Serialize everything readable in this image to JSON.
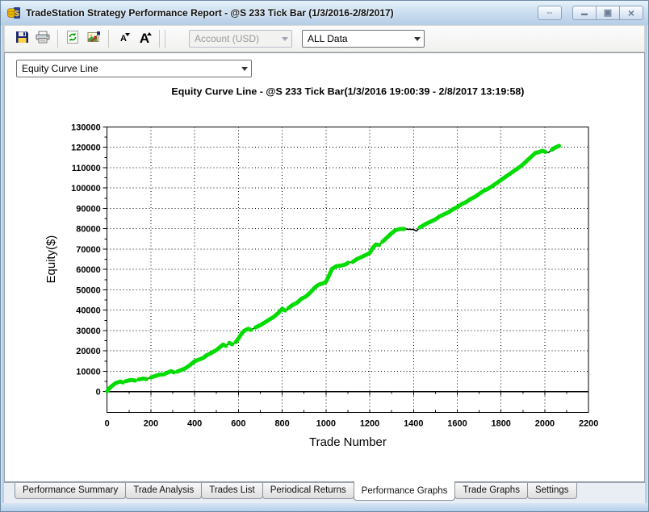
{
  "window": {
    "title": "TradeStation Strategy Performance Report - @S 233 Tick Bar (1/3/2016-2/8/2017)",
    "controls": {
      "resize": "⇔",
      "minimize": "▬",
      "restore": "▣",
      "close": "×"
    }
  },
  "toolbar": {
    "buttons": [
      {
        "name": "save"
      },
      {
        "name": "print"
      },
      {
        "name": "refresh"
      },
      {
        "name": "export-settings"
      },
      {
        "name": "decrease-font",
        "glyph": "A"
      },
      {
        "name": "increase-font",
        "glyph": "A"
      }
    ],
    "account_dropdown": {
      "value": "Account (USD)",
      "disabled": true
    },
    "data_dropdown": {
      "value": "ALL Data",
      "disabled": false
    }
  },
  "graph_selector": {
    "value": "Equity Curve Line"
  },
  "tabs": {
    "items": [
      "Performance Summary",
      "Trade Analysis",
      "Trades List",
      "Periodical Returns",
      "Performance Graphs",
      "Trade Graphs",
      "Settings"
    ],
    "active": "Performance Graphs"
  },
  "chart_data": {
    "type": "line",
    "title": "Equity Curve Line - @S 233 Tick Bar(1/3/2016 19:00:39 - 2/8/2017 13:19:58)",
    "xlabel": "Trade Number",
    "ylabel": "Equity($)",
    "xlim": [
      0,
      2200
    ],
    "ylim": [
      0,
      130000
    ],
    "x_ticks": [
      0,
      200,
      400,
      600,
      800,
      1000,
      1200,
      1400,
      1600,
      1800,
      2000,
      2200
    ],
    "y_ticks": [
      0,
      10000,
      20000,
      30000,
      40000,
      50000,
      60000,
      70000,
      80000,
      90000,
      100000,
      110000,
      120000,
      130000
    ],
    "grid": "dotted",
    "legend": "none",
    "line_color": "#00dc00",
    "drawdown_color": "#000000",
    "series": [
      {
        "name": "Equity",
        "points": [
          [
            0,
            200,
            1
          ],
          [
            12,
            1800,
            1
          ],
          [
            25,
            3000,
            1
          ],
          [
            40,
            4200,
            1
          ],
          [
            60,
            4900,
            1
          ],
          [
            72,
            4500,
            0
          ],
          [
            85,
            5100,
            1
          ],
          [
            110,
            5700,
            1
          ],
          [
            128,
            5400,
            0
          ],
          [
            145,
            6000,
            1
          ],
          [
            165,
            6400,
            1
          ],
          [
            180,
            6100,
            0
          ],
          [
            200,
            6900,
            1
          ],
          [
            220,
            7700,
            1
          ],
          [
            240,
            8300,
            1
          ],
          [
            258,
            8400,
            1
          ],
          [
            275,
            9300,
            1
          ],
          [
            292,
            10000,
            1
          ],
          [
            305,
            9400,
            0
          ],
          [
            320,
            9800,
            1
          ],
          [
            340,
            10600,
            1
          ],
          [
            360,
            11600,
            1
          ],
          [
            380,
            13100,
            1
          ],
          [
            400,
            14900,
            1
          ],
          [
            420,
            15700,
            1
          ],
          [
            440,
            16600,
            1
          ],
          [
            455,
            17900,
            1
          ],
          [
            470,
            18600,
            1
          ],
          [
            488,
            19700,
            1
          ],
          [
            502,
            20600,
            1
          ],
          [
            516,
            21900,
            1
          ],
          [
            530,
            23100,
            1
          ],
          [
            543,
            22400,
            0
          ],
          [
            558,
            23900,
            1
          ],
          [
            572,
            23200,
            0
          ],
          [
            588,
            24300,
            1
          ],
          [
            602,
            26300,
            1
          ],
          [
            614,
            28400,
            1
          ],
          [
            628,
            30000,
            1
          ],
          [
            644,
            30800,
            1
          ],
          [
            658,
            30300,
            0
          ],
          [
            678,
            31500,
            1
          ],
          [
            700,
            32600,
            1
          ],
          [
            720,
            33900,
            1
          ],
          [
            740,
            35300,
            1
          ],
          [
            762,
            36700,
            1
          ],
          [
            782,
            38600,
            1
          ],
          [
            800,
            40700,
            1
          ],
          [
            813,
            39800,
            0
          ],
          [
            828,
            41000,
            1
          ],
          [
            848,
            42600,
            1
          ],
          [
            868,
            43600,
            1
          ],
          [
            888,
            45600,
            1
          ],
          [
            908,
            46700,
            1
          ],
          [
            928,
            48600,
            1
          ],
          [
            948,
            51000,
            1
          ],
          [
            966,
            52500,
            1
          ],
          [
            984,
            53100,
            1
          ],
          [
            1000,
            53900,
            1
          ],
          [
            1014,
            57000,
            1
          ],
          [
            1028,
            60300,
            1
          ],
          [
            1048,
            61600,
            1
          ],
          [
            1068,
            61900,
            1
          ],
          [
            1088,
            62400,
            1
          ],
          [
            1102,
            63300,
            0
          ],
          [
            1122,
            63700,
            1
          ],
          [
            1142,
            65100,
            1
          ],
          [
            1162,
            66100,
            1
          ],
          [
            1182,
            67100,
            1
          ],
          [
            1200,
            68100,
            1
          ],
          [
            1214,
            70600,
            1
          ],
          [
            1228,
            72300,
            1
          ],
          [
            1243,
            72000,
            0
          ],
          [
            1258,
            73600,
            1
          ],
          [
            1278,
            75600,
            1
          ],
          [
            1298,
            77600,
            1
          ],
          [
            1318,
            79300,
            1
          ],
          [
            1338,
            79900,
            1
          ],
          [
            1358,
            79900,
            0
          ],
          [
            1382,
            79700,
            0
          ],
          [
            1400,
            79600,
            0
          ],
          [
            1413,
            78900,
            0
          ],
          [
            1428,
            80600,
            1
          ],
          [
            1444,
            81600,
            1
          ],
          [
            1460,
            82600,
            1
          ],
          [
            1480,
            83600,
            1
          ],
          [
            1500,
            84600,
            1
          ],
          [
            1520,
            86100,
            1
          ],
          [
            1540,
            87100,
            1
          ],
          [
            1560,
            88100,
            1
          ],
          [
            1580,
            89600,
            1
          ],
          [
            1600,
            90600,
            1
          ],
          [
            1620,
            92100,
            1
          ],
          [
            1640,
            93100,
            1
          ],
          [
            1660,
            94600,
            1
          ],
          [
            1680,
            95600,
            1
          ],
          [
            1700,
            97100,
            1
          ],
          [
            1720,
            98600,
            1
          ],
          [
            1740,
            99600,
            1
          ],
          [
            1762,
            101100,
            1
          ],
          [
            1782,
            102600,
            1
          ],
          [
            1802,
            104100,
            1
          ],
          [
            1822,
            105600,
            1
          ],
          [
            1842,
            107100,
            1
          ],
          [
            1862,
            108600,
            1
          ],
          [
            1882,
            110100,
            1
          ],
          [
            1900,
            111600,
            1
          ],
          [
            1915,
            113100,
            1
          ],
          [
            1930,
            114600,
            1
          ],
          [
            1945,
            116100,
            1
          ],
          [
            1958,
            117300,
            1
          ],
          [
            1972,
            117600,
            1
          ],
          [
            1988,
            118300,
            1
          ],
          [
            2003,
            117700,
            0
          ],
          [
            2018,
            117500,
            0
          ],
          [
            2032,
            118800,
            1
          ],
          [
            2048,
            119900,
            1
          ],
          [
            2065,
            120700,
            1
          ]
        ]
      }
    ]
  }
}
